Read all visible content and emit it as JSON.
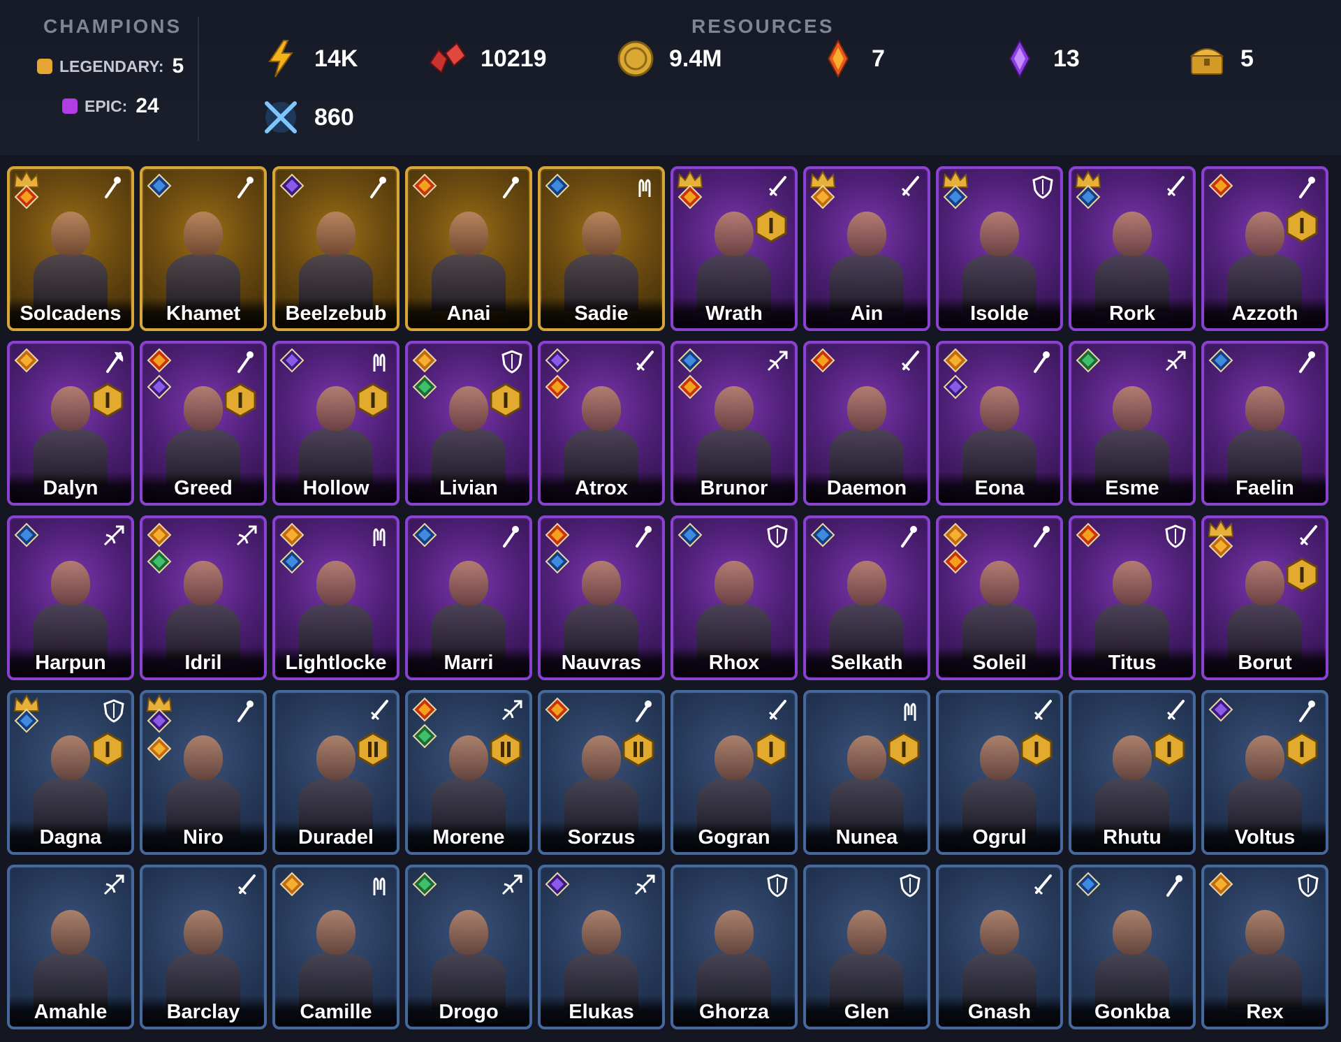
{
  "header": {
    "champions_title": "CHAMPIONS",
    "resources_title": "RESOURCES",
    "legendary_label": "LEGENDARY:",
    "legendary_count": "5",
    "epic_label": "EPIC:",
    "epic_count": "24",
    "colors": {
      "legendary": "#e5a632",
      "epic": "#b43ce6"
    }
  },
  "resources": [
    {
      "icon": "energy-bolt-icon",
      "value": "14K"
    },
    {
      "icon": "rubies-icon",
      "value": "10219"
    },
    {
      "icon": "gold-coin-icon",
      "value": "9.4M"
    },
    {
      "icon": "legendary-shard-icon",
      "value": "7"
    },
    {
      "icon": "epic-shard-icon",
      "value": "13"
    },
    {
      "icon": "gold-chest-icon",
      "value": "5"
    },
    {
      "icon": "crossed-swords-icon",
      "value": "860"
    }
  ],
  "champions": [
    {
      "name": "Solcadens",
      "rarity": "legendary",
      "class": "wand",
      "crown": true,
      "affinities": [
        "fire"
      ],
      "rank": ""
    },
    {
      "name": "Khamet",
      "rarity": "legendary",
      "class": "wand",
      "crown": false,
      "affinities": [
        "water"
      ],
      "rank": ""
    },
    {
      "name": "Beelzebub",
      "rarity": "legendary",
      "class": "wand",
      "crown": false,
      "affinities": [
        "void"
      ],
      "rank": ""
    },
    {
      "name": "Anai",
      "rarity": "legendary",
      "class": "wand",
      "crown": false,
      "affinities": [
        "fire"
      ],
      "rank": ""
    },
    {
      "name": "Sadie",
      "rarity": "legendary",
      "class": "hands",
      "crown": false,
      "affinities": [
        "water"
      ],
      "rank": ""
    },
    {
      "name": "Wrath",
      "rarity": "epic",
      "class": "sword",
      "crown": true,
      "affinities": [
        "fire"
      ],
      "rank": "I"
    },
    {
      "name": "Ain",
      "rarity": "epic",
      "class": "sword",
      "crown": true,
      "affinities": [
        "force"
      ],
      "rank": ""
    },
    {
      "name": "Isolde",
      "rarity": "epic",
      "class": "shield",
      "crown": true,
      "affinities": [
        "water"
      ],
      "rank": ""
    },
    {
      "name": "Rork",
      "rarity": "epic",
      "class": "sword",
      "crown": true,
      "affinities": [
        "water"
      ],
      "rank": ""
    },
    {
      "name": "Azzoth",
      "rarity": "epic",
      "class": "wand",
      "crown": false,
      "affinities": [
        "fire"
      ],
      "rank": "I"
    },
    {
      "name": "Dalyn",
      "rarity": "epic",
      "class": "axe",
      "crown": false,
      "affinities": [
        "force"
      ],
      "rank": "I"
    },
    {
      "name": "Greed",
      "rarity": "epic",
      "class": "wand",
      "crown": false,
      "affinities": [
        "fire",
        "void"
      ],
      "rank": "I"
    },
    {
      "name": "Hollow",
      "rarity": "epic",
      "class": "hands",
      "crown": false,
      "affinities": [
        "void"
      ],
      "rank": "I"
    },
    {
      "name": "Livian",
      "rarity": "epic",
      "class": "shield",
      "crown": false,
      "affinities": [
        "force",
        "nature"
      ],
      "rank": "I"
    },
    {
      "name": "Atrox",
      "rarity": "epic",
      "class": "sword",
      "crown": false,
      "affinities": [
        "void",
        "fire"
      ],
      "rank": ""
    },
    {
      "name": "Brunor",
      "rarity": "epic",
      "class": "bow",
      "crown": false,
      "affinities": [
        "water",
        "fire"
      ],
      "rank": ""
    },
    {
      "name": "Daemon",
      "rarity": "epic",
      "class": "sword",
      "crown": false,
      "affinities": [
        "fire"
      ],
      "rank": ""
    },
    {
      "name": "Eona",
      "rarity": "epic",
      "class": "wand",
      "crown": false,
      "affinities": [
        "force",
        "void"
      ],
      "rank": ""
    },
    {
      "name": "Esme",
      "rarity": "epic",
      "class": "bow",
      "crown": false,
      "affinities": [
        "nature"
      ],
      "rank": ""
    },
    {
      "name": "Faelin",
      "rarity": "epic",
      "class": "wand",
      "crown": false,
      "affinities": [
        "water"
      ],
      "rank": ""
    },
    {
      "name": "Harpun",
      "rarity": "epic",
      "class": "bow",
      "crown": false,
      "affinities": [
        "water"
      ],
      "rank": ""
    },
    {
      "name": "Idril",
      "rarity": "epic",
      "class": "bow",
      "crown": false,
      "affinities": [
        "force",
        "nature"
      ],
      "rank": ""
    },
    {
      "name": "Lightlocke",
      "rarity": "epic",
      "class": "hands",
      "crown": false,
      "affinities": [
        "force",
        "water"
      ],
      "rank": ""
    },
    {
      "name": "Marri",
      "rarity": "epic",
      "class": "wand",
      "crown": false,
      "affinities": [
        "water"
      ],
      "rank": ""
    },
    {
      "name": "Nauvras",
      "rarity": "epic",
      "class": "wand",
      "crown": false,
      "affinities": [
        "fire",
        "water"
      ],
      "rank": ""
    },
    {
      "name": "Rhox",
      "rarity": "epic",
      "class": "shield",
      "crown": false,
      "affinities": [
        "water"
      ],
      "rank": ""
    },
    {
      "name": "Selkath",
      "rarity": "epic",
      "class": "wand",
      "crown": false,
      "affinities": [
        "water"
      ],
      "rank": ""
    },
    {
      "name": "Soleil",
      "rarity": "epic",
      "class": "wand",
      "crown": false,
      "affinities": [
        "force",
        "fire"
      ],
      "rank": ""
    },
    {
      "name": "Titus",
      "rarity": "epic",
      "class": "shield",
      "crown": false,
      "affinities": [
        "fire"
      ],
      "rank": ""
    },
    {
      "name": "Borut",
      "rarity": "epic",
      "class": "sword",
      "crown": true,
      "affinities": [
        "force"
      ],
      "rank": "I"
    },
    {
      "name": "Dagna",
      "rarity": "rare",
      "class": "shield",
      "crown": true,
      "affinities": [
        "water"
      ],
      "rank": "I"
    },
    {
      "name": "Niro",
      "rarity": "rare",
      "class": "wand",
      "crown": true,
      "affinities": [
        "void",
        "force"
      ],
      "rank": ""
    },
    {
      "name": "Duradel",
      "rarity": "rare",
      "class": "sword",
      "crown": false,
      "affinities": [],
      "rank": "II"
    },
    {
      "name": "Morene",
      "rarity": "rare",
      "class": "bow",
      "crown": false,
      "affinities": [
        "fire",
        "nature"
      ],
      "rank": "II"
    },
    {
      "name": "Sorzus",
      "rarity": "rare",
      "class": "wand",
      "crown": false,
      "affinities": [
        "fire"
      ],
      "rank": "II"
    },
    {
      "name": "Gogran",
      "rarity": "rare",
      "class": "sword",
      "crown": false,
      "affinities": [],
      "rank": "I"
    },
    {
      "name": "Nunea",
      "rarity": "rare",
      "class": "hands",
      "crown": false,
      "affinities": [],
      "rank": "I"
    },
    {
      "name": "Ogrul",
      "rarity": "rare",
      "class": "sword",
      "crown": false,
      "affinities": [],
      "rank": "I"
    },
    {
      "name": "Rhutu",
      "rarity": "rare",
      "class": "sword",
      "crown": false,
      "affinities": [],
      "rank": "I"
    },
    {
      "name": "Voltus",
      "rarity": "rare",
      "class": "wand",
      "crown": false,
      "affinities": [
        "void"
      ],
      "rank": "I"
    },
    {
      "name": "Amahle",
      "rarity": "rare",
      "class": "bow",
      "crown": false,
      "affinities": [],
      "rank": ""
    },
    {
      "name": "Barclay",
      "rarity": "rare",
      "class": "sword",
      "crown": false,
      "affinities": [],
      "rank": ""
    },
    {
      "name": "Camille",
      "rarity": "rare",
      "class": "hands",
      "crown": false,
      "affinities": [
        "force"
      ],
      "rank": ""
    },
    {
      "name": "Drogo",
      "rarity": "rare",
      "class": "bow",
      "crown": false,
      "affinities": [
        "nature"
      ],
      "rank": ""
    },
    {
      "name": "Elukas",
      "rarity": "rare",
      "class": "bow",
      "crown": false,
      "affinities": [
        "void"
      ],
      "rank": ""
    },
    {
      "name": "Ghorza",
      "rarity": "rare",
      "class": "shield",
      "crown": false,
      "affinities": [],
      "rank": ""
    },
    {
      "name": "Glen",
      "rarity": "rare",
      "class": "shield",
      "crown": false,
      "affinities": [],
      "rank": ""
    },
    {
      "name": "Gnash",
      "rarity": "rare",
      "class": "sword",
      "crown": false,
      "affinities": [],
      "rank": ""
    },
    {
      "name": "Gonkba",
      "rarity": "rare",
      "class": "wand",
      "crown": false,
      "affinities": [
        "water"
      ],
      "rank": ""
    },
    {
      "name": "Rex",
      "rarity": "rare",
      "class": "shield",
      "crown": false,
      "affinities": [
        "force"
      ],
      "rank": ""
    }
  ]
}
